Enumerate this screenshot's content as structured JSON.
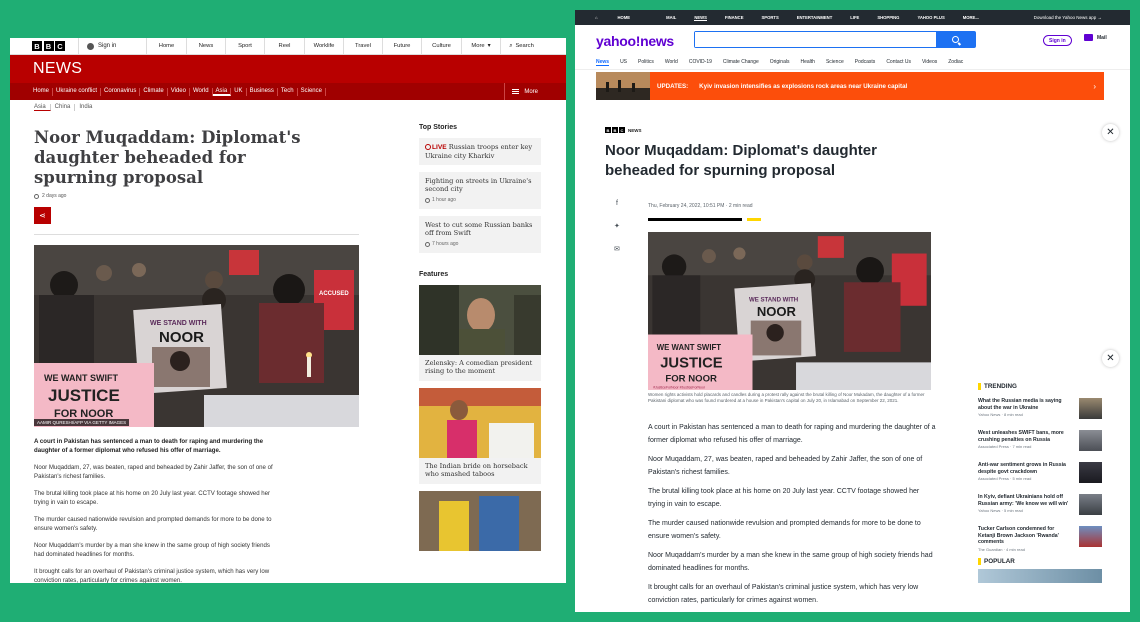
{
  "bbc": {
    "logo": [
      "B",
      "B",
      "C"
    ],
    "sign_in": "Sign in",
    "nav": [
      "Home",
      "News",
      "Sport",
      "Reel",
      "Worklife",
      "Travel",
      "Future",
      "Culture",
      "More",
      "Search"
    ],
    "section": "NEWS",
    "subnav": [
      "Home",
      "Ukraine conflict",
      "Coronavirus",
      "Climate",
      "Video",
      "World",
      "Asia",
      "UK",
      "Business",
      "Tech",
      "Science"
    ],
    "subnav_selected": "Asia",
    "more": "More",
    "regions": [
      "Asia",
      "China",
      "India"
    ],
    "headline": "Noor Muqaddam: Diplomat's daughter beheaded for spurning proposal",
    "time": "2 days ago",
    "image_credit": "AAMIR QURESHI/AFP VIA GETTY IMAGES",
    "body": [
      "A court in Pakistan has sentenced a man to death for raping and murdering the daughter of a former diplomat who refused his offer of marriage.",
      "Noor Muqaddam, 27, was beaten, raped and beheaded by Zahir Jaffer, the son of one of Pakistan's richest families.",
      "The brutal killing took place at his home on 20 July last year. CCTV footage showed her trying in vain to escape.",
      "The murder caused nationwide revulsion and prompted demands for more to be done to ensure women's safety.",
      "Noor Muqaddam's murder by a man she knew in the same group of high society friends had dominated headlines for months.",
      "It brought calls for an overhaul of Pakistan's criminal justice system, which has very low conviction rates, particularly for crimes against women."
    ],
    "top_stories_title": "Top Stories",
    "top_stories": [
      {
        "live": "LIVE",
        "title": "Russian troops enter key Ukraine city Kharkiv",
        "time": ""
      },
      {
        "live": "",
        "title": "Fighting on streets in Ukraine's second city",
        "time": "1 hour ago"
      },
      {
        "live": "",
        "title": "West to cut some Russian banks off from Swift",
        "time": "7 hours ago"
      }
    ],
    "features_title": "Features",
    "features": [
      {
        "title": "Zelensky: A comedian president rising to the moment"
      },
      {
        "title": "The Indian bride on horseback who smashed taboos"
      }
    ]
  },
  "yahoo": {
    "topnav": [
      "HOME",
      "MAIL",
      "NEWS",
      "FINANCE",
      "SPORTS",
      "ENTERTAINMENT",
      "LIFE",
      "SHOPPING",
      "YAHOO PLUS",
      "MORE..."
    ],
    "download": "Download the Yahoo News app",
    "logo": "yahoo!news",
    "sign_in": "Sign in",
    "mail": "Mail",
    "nav": [
      "News",
      "US",
      "Politics",
      "World",
      "COVID-19",
      "Climate Change",
      "Originals",
      "Health",
      "Science",
      "Podcasts",
      "Contact Us",
      "Videos",
      "Zodiac"
    ],
    "updates_label": "UPDATES:",
    "updates_text": "Kyiv invasion intensifies as explosions rock areas near Ukraine capital",
    "source": "NEWS",
    "headline": "Noor Muqaddam: Diplomat's daughter beheaded for spurning proposal",
    "meta": "Thu, February 24, 2022, 10:51 PM  ·  2 min read",
    "caption": "Women rights activists hold placards and candles during a protest rally against the brutal killing of Noor Mukadam, the daughter of a former Pakistani diplomat who was found murdered at a house in Pakistan's capital on July 20, in Islamabad on September 22, 2021.",
    "body": [
      "A court in Pakistan has sentenced a man to death for raping and murdering the daughter of a former diplomat who refused his offer of marriage.",
      "Noor Muqaddam, 27, was beaten, raped and beheaded by Zahir Jaffer, the son of one of Pakistan's richest families.",
      "The brutal killing took place at his home on 20 July last year. CCTV footage showed her trying in vain to escape.",
      "The murder caused nationwide revulsion and prompted demands for more to be done to ensure women's safety.",
      "Noor Muqaddam's murder by a man she knew in the same group of high society friends had dominated headlines for months.",
      "It brought calls for an overhaul of Pakistan's criminal justice system, which has very low conviction rates, particularly for crimes against women."
    ],
    "trending_title": "TRENDING",
    "trending": [
      {
        "title": "What the Russian media is saying about the war in Ukraine",
        "src": "Yahoo News · 8 min read"
      },
      {
        "title": "West unleashes SWIFT bans, more crushing penalties on Russia",
        "src": "Associated Press · 7 min read"
      },
      {
        "title": "Anti-war sentiment grows in Russia despite govt crackdown",
        "src": "Associated Press · 5 min read"
      },
      {
        "title": "In Kyiv, defiant Ukrainians hold off Russian army: 'We know we will win'",
        "src": "Yahoo News · 5 min read"
      },
      {
        "title": "Tucker Carlson condemned for Ketanji Brown Jackson 'Rwanda' comments",
        "src": "The Guardian · 4 min read"
      }
    ],
    "popular_title": "POPULAR"
  },
  "photo": {
    "sign1": "WE STAND WITH",
    "sign1b": "NOOR",
    "sign2": "WE WANT SWIFT",
    "sign2b": "JUSTICE",
    "sign2c": "FOR NOOR",
    "sign2d": "#JusticeForNoor #JusticeForNoor",
    "sign3": "ACCUSED"
  },
  "colors": {
    "bbc_red": "#b80000",
    "yahoo_purple": "#6001d2",
    "yahoo_blue": "#1d71f2",
    "updates_orange": "#fc4e0b",
    "trending_yellow": "#ffd600"
  }
}
